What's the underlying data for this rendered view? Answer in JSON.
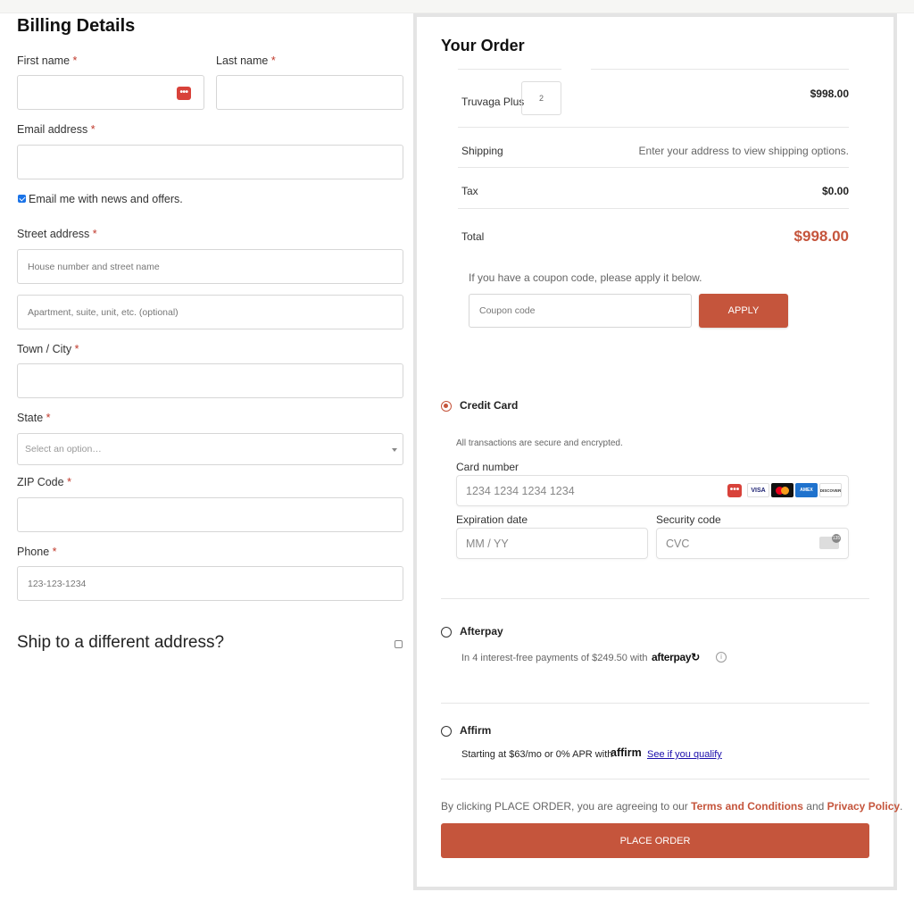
{
  "billing": {
    "title": "Billing Details",
    "first_name_label": "First name",
    "last_name_label": "Last name",
    "email_label": "Email address",
    "email_optin_label": "Email me with news and offers.",
    "email_optin_checked": true,
    "street_label": "Street address",
    "street1_placeholder": "House number and street name",
    "street2_placeholder": "Apartment, suite, unit, etc. (optional)",
    "city_label": "Town / City",
    "state_label": "State",
    "state_selected": "Select an option…",
    "zip_label": "ZIP Code",
    "phone_label": "Phone",
    "phone_placeholder": "123-123-1234",
    "required_mark": "*",
    "ship_different_label": "Ship to a different address?"
  },
  "order": {
    "title": "Your Order",
    "item_name": "Truvaga Plus",
    "item_qty": "2",
    "item_price": "$998.00",
    "shipping_label": "Shipping",
    "shipping_value": "Enter your address to view shipping options.",
    "tax_label": "Tax",
    "tax_value": "$0.00",
    "total_label": "Total",
    "total_value": "$998.00",
    "coupon_prompt": "If you have a coupon code, please apply it below.",
    "coupon_placeholder": "Coupon code",
    "apply_label": "APPLY"
  },
  "payment": {
    "credit_card_label": "Credit Card",
    "secure_note": "All transactions are secure and encrypted.",
    "card_number_label": "Card number",
    "card_number_placeholder": "1234 1234 1234 1234",
    "expiration_label": "Expiration date",
    "expiration_placeholder": "MM / YY",
    "security_label": "Security code",
    "security_placeholder": "CVC",
    "brands": [
      "VISA",
      "MC",
      "AMEX",
      "DISCOVER"
    ],
    "afterpay_label": "Afterpay",
    "afterpay_text": "In 4 interest-free payments of $249.50 with",
    "afterpay_logo": "afterpay",
    "affirm_label": "Affirm",
    "affirm_text": "Starting at $63/mo or 0% APR with",
    "affirm_logo": "affirm",
    "affirm_link": "See if you qualify"
  },
  "footer": {
    "agree_prefix": "By clicking PLACE ORDER, you are agreeing to our",
    "terms_link": "Terms and Conditions",
    "and_word": "and",
    "privacy_link": "Privacy Policy",
    "period": ".",
    "place_order_label": "PLACE ORDER"
  },
  "colors": {
    "accent": "#c5553c",
    "required": "#c0392b",
    "affirm_link": "#1a0dab"
  }
}
